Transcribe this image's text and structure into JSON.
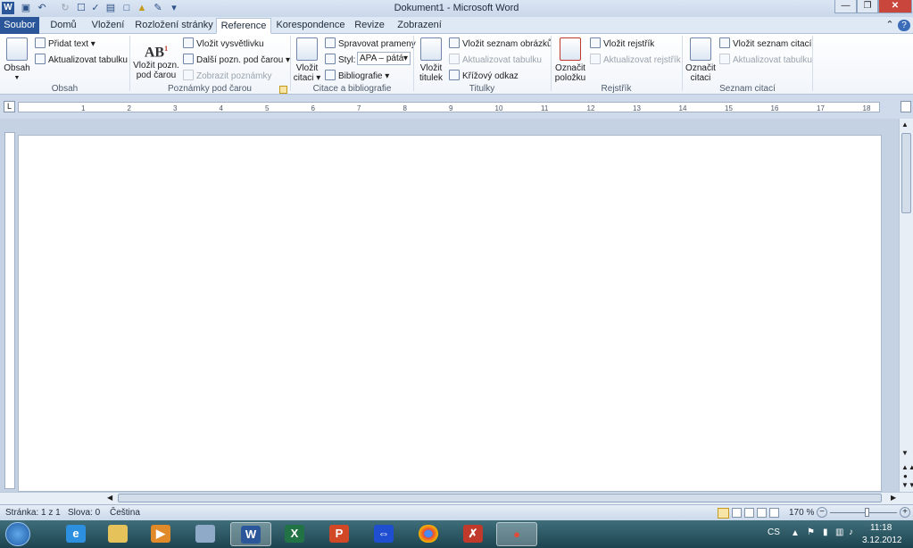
{
  "window": {
    "title": "Dokument1 - Microsoft Word"
  },
  "tabs": [
    {
      "label": "Soubor"
    },
    {
      "label": "Domů"
    },
    {
      "label": "Vložení"
    },
    {
      "label": "Rozložení stránky"
    },
    {
      "label": "Reference"
    },
    {
      "label": "Korespondence"
    },
    {
      "label": "Revize"
    },
    {
      "label": "Zobrazení"
    }
  ],
  "ribbon": {
    "obsah": {
      "big_label": "Obsah",
      "add_text": "Přidat text",
      "update_table": "Aktualizovat tabulku",
      "group": "Obsah"
    },
    "footnotes": {
      "insert_footnote": "Vložit pozn.",
      "insert_footnote_2": "pod čarou",
      "insert_endnote": "Vložit vysvětlivku",
      "next_footnote": "Další pozn. pod čarou",
      "show_notes": "Zobrazit poznámky",
      "group": "Poznámky pod čarou"
    },
    "citations": {
      "insert_citation": "Vložit",
      "insert_citation_2": "citaci",
      "manage_sources": "Spravovat prameny",
      "style_label": "Styl:",
      "style_value": "APA – pátá",
      "bibliography": "Bibliografie",
      "group": "Citace a bibliografie"
    },
    "captions": {
      "insert_caption": "Vložit",
      "insert_caption_2": "titulek",
      "insert_table_of_figures": "Vložit seznam obrázků",
      "update_table": "Aktualizovat tabulku",
      "cross_reference": "Křížový odkaz",
      "group": "Titulky"
    },
    "index": {
      "mark_entry": "Označit",
      "mark_entry_2": "položku",
      "insert_index": "Vložit rejstřík",
      "update_index": "Aktualizovat rejstřík",
      "group": "Rejstřík"
    },
    "authorities": {
      "mark_citation": "Označit",
      "mark_citation_2": "citaci",
      "insert_table": "Vložit seznam citací",
      "update_table": "Aktualizovat tabulku",
      "group": "Seznam citací"
    }
  },
  "ruler": {
    "ticks": [
      "1",
      "2",
      "3",
      "4",
      "5",
      "6",
      "7",
      "8",
      "9",
      "10",
      "11",
      "12",
      "13",
      "14",
      "15",
      "16",
      "17",
      "18"
    ]
  },
  "status": {
    "page": "Stránka: 1 z 1",
    "words": "Slova: 0",
    "language": "Čeština",
    "zoom": "170 %"
  },
  "tray": {
    "lang": "CS",
    "time": "11:18",
    "date": "3.12.2012"
  }
}
